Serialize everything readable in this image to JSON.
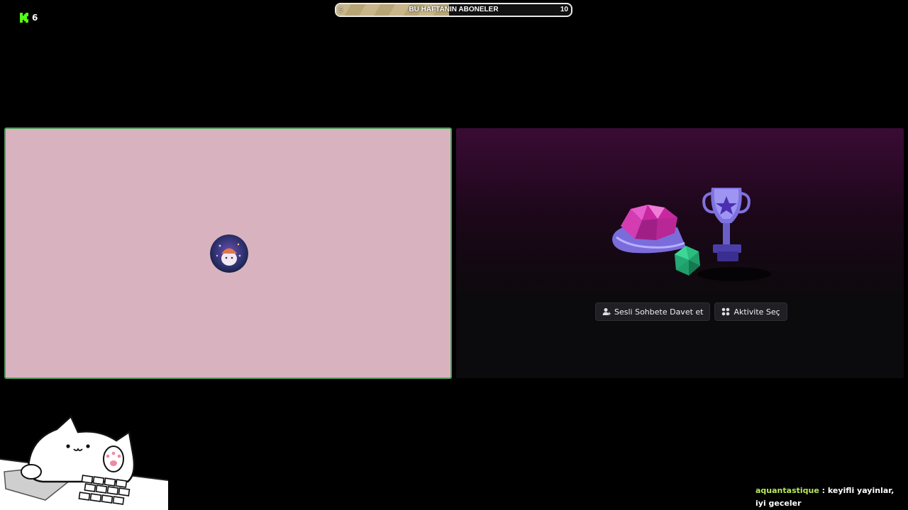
{
  "viewers": {
    "count": "6",
    "brand_color": "#53fc18"
  },
  "goal": {
    "title": "BU HAFTANIN ABONELER",
    "start": "5",
    "end": "10",
    "progress_fraction": 0.48
  },
  "video_tile": {
    "background": "#d8b3bf",
    "border": "#4f9a5a",
    "avatar_icon": "user-avatar-icon"
  },
  "activity": {
    "invite_button_label": "Sesli Sohbete Davet et",
    "choose_activity_label": "Aktivite Seç"
  },
  "chat": {
    "username": "aquantastique",
    "separator": " : ",
    "message": "keyifli yayinlar, iyi geceler"
  }
}
